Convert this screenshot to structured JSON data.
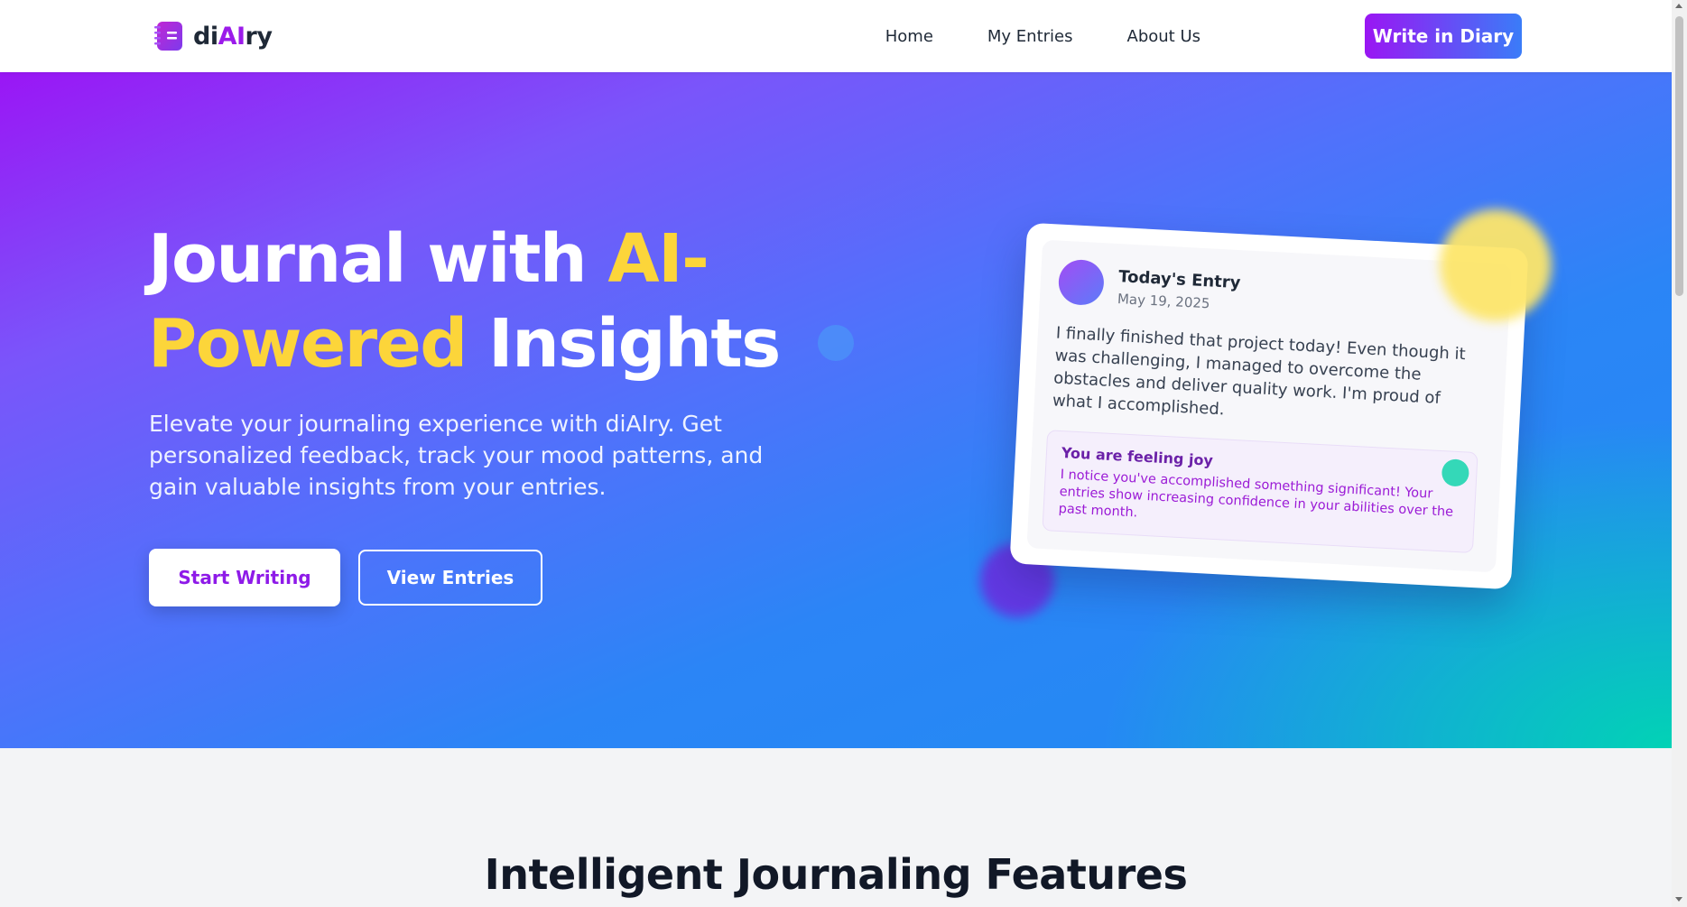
{
  "nav": {
    "logo": {
      "prefix": "di",
      "highlight": "AI",
      "suffix": "ry",
      "icon": "notebook-icon"
    },
    "links": [
      "Home",
      "My Entries",
      "About Us"
    ],
    "cta": "Write in Diary"
  },
  "hero": {
    "title_part1": "Journal with ",
    "title_highlight1": "AI-",
    "title_highlight2": "Powered",
    "title_part2": " Insights",
    "subtitle": "Elevate your journaling experience with diAIry. Get personalized feedback, track your mood patterns, and gain valuable insights from your entries.",
    "primary_button": "Start Writing",
    "secondary_button": "View Entries"
  },
  "entry_card": {
    "title": "Today's Entry",
    "date": "May 19, 2025",
    "text": "I finally finished that project today! Even though it was challenging, I managed to overcome the obstacles and deliver quality work. I'm proud of what I accomplished.",
    "feeling_title": "You are feeling joy",
    "feeling_text": "I notice you've accomplished something significant! Your entries show increasing confidence in your abilities over the past month."
  },
  "features": {
    "title": "Intelligent Journaling Features"
  },
  "colors": {
    "brand_purple": "#9a16f3",
    "brand_blue": "#3a7cf8",
    "highlight_yellow": "#fcd53a",
    "accent_teal": "#34d8b8"
  }
}
